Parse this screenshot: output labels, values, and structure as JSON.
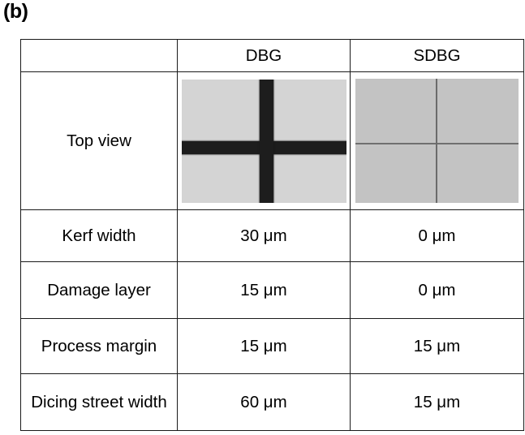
{
  "figure": {
    "label": "(b)"
  },
  "table": {
    "columns": [
      {
        "key": "label",
        "header": ""
      },
      {
        "key": "dbg",
        "header": "DBG"
      },
      {
        "key": "sdbg",
        "header": "SDBG"
      }
    ],
    "rows": [
      {
        "label": "Top view",
        "type": "image",
        "dbg": "dbg-top-view-micrograph",
        "sdbg": "sdbg-top-view-micrograph",
        "highlight": false
      },
      {
        "label": "Kerf width",
        "type": "value",
        "dbg": "30 μm",
        "sdbg": "0 μm",
        "highlight": false
      },
      {
        "label": "Damage layer",
        "type": "value",
        "dbg": "15 μm",
        "sdbg": "0 μm",
        "highlight": false
      },
      {
        "label": "Process margin",
        "type": "value",
        "dbg": "15 μm",
        "sdbg": "15 μm",
        "highlight": false
      },
      {
        "label": "Dicing street width",
        "type": "value",
        "dbg": "60 μm",
        "sdbg": "15 μm",
        "highlight": true
      }
    ]
  },
  "colors": {
    "highlight_text": "#1579c6",
    "border": "#1a1a1a",
    "dbg_background": "#d4d4d4",
    "dbg_street": "#1d1d1d",
    "sdbg_background": "#c3c3c3",
    "sdbg_street": "#6b6b6b"
  }
}
